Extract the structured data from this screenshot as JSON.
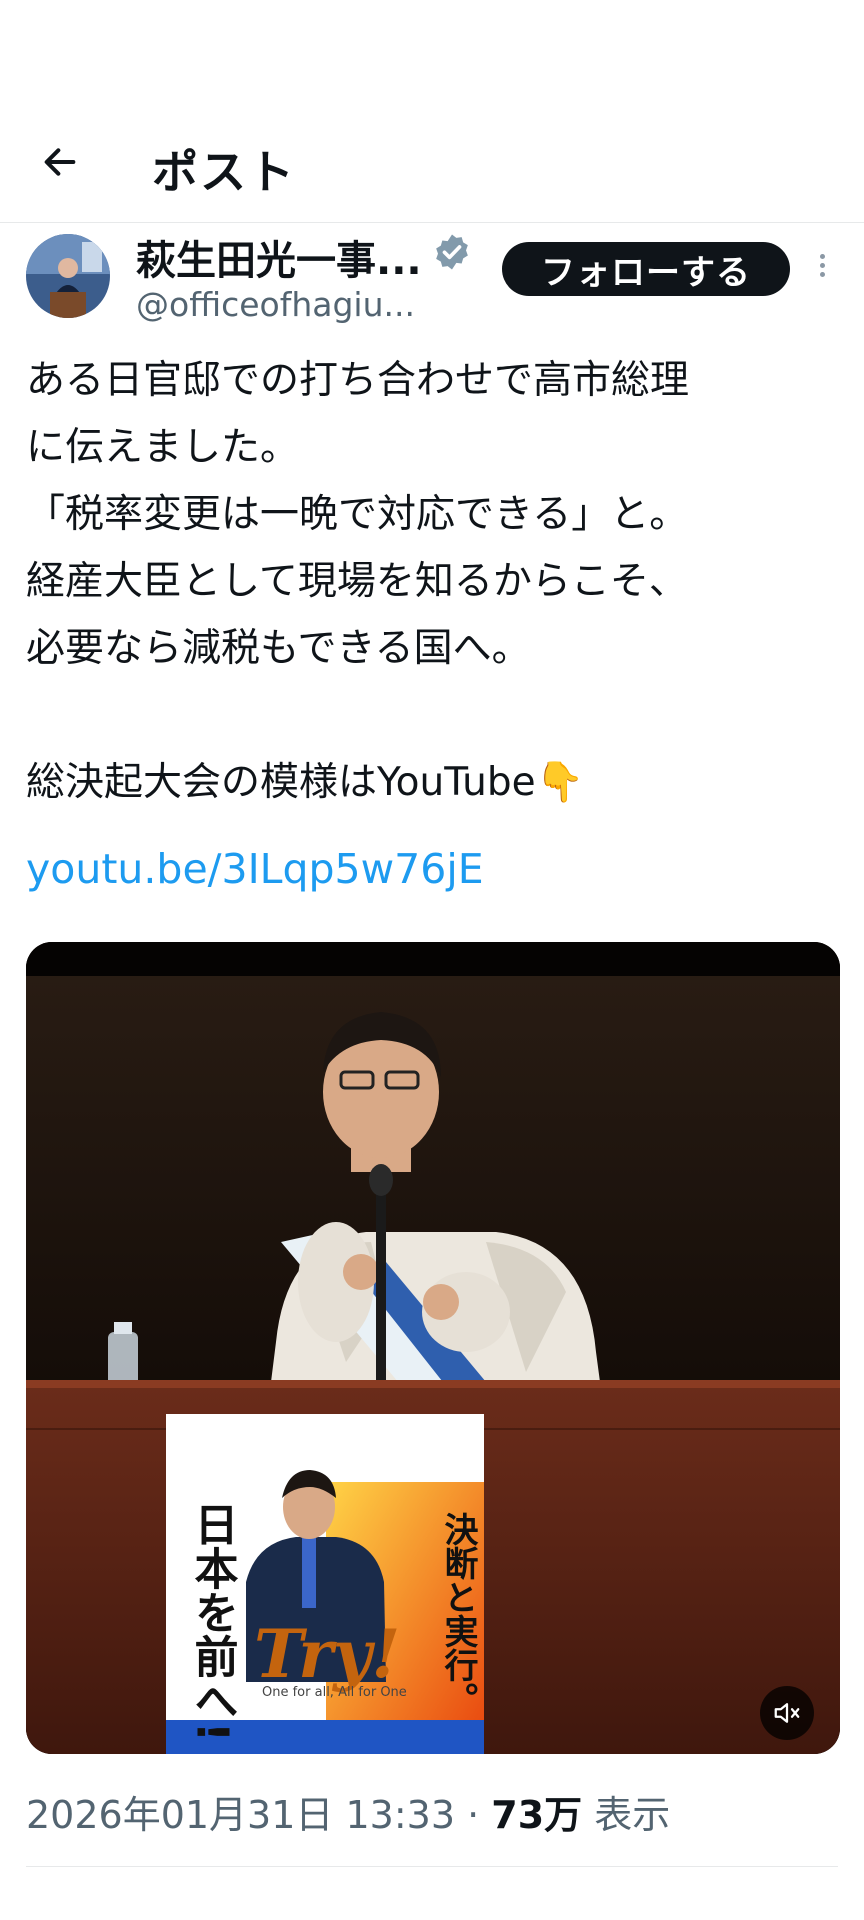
{
  "header": {
    "title": "ポスト",
    "back_icon": "arrow-left-icon"
  },
  "author": {
    "name": "萩生田光一事...",
    "handle": "@officeofhagiu...",
    "verified_icon": "verified-badge-icon",
    "verified_color": "#829aab"
  },
  "actions": {
    "follow_label": "フォローする",
    "more_icon": "more-vertical-icon"
  },
  "post": {
    "text": "ある日官邸での打ち合わせで高市総理\nに伝えました。\n「税率変更は一晩で対応できる」と。\n経産大臣として現場を知るからこそ、\n必要なら減税もできる国へ。\n\n総決起大会の模様はYouTube👇",
    "link": "youtu.be/3ILqp5w76jE",
    "link_color": "#1d9bf0"
  },
  "media": {
    "type": "video",
    "mute_icon": "speaker-muted-icon",
    "poster": {
      "slogan_left": "日本を前へ!",
      "slogan_right": "決断と実行。",
      "try_text": "Try!",
      "try_sub": "One for all, All for One"
    }
  },
  "meta": {
    "timestamp": "2026年01月31日 13:33",
    "separator": " · ",
    "views_count": "73万",
    "views_label": " 表示"
  }
}
